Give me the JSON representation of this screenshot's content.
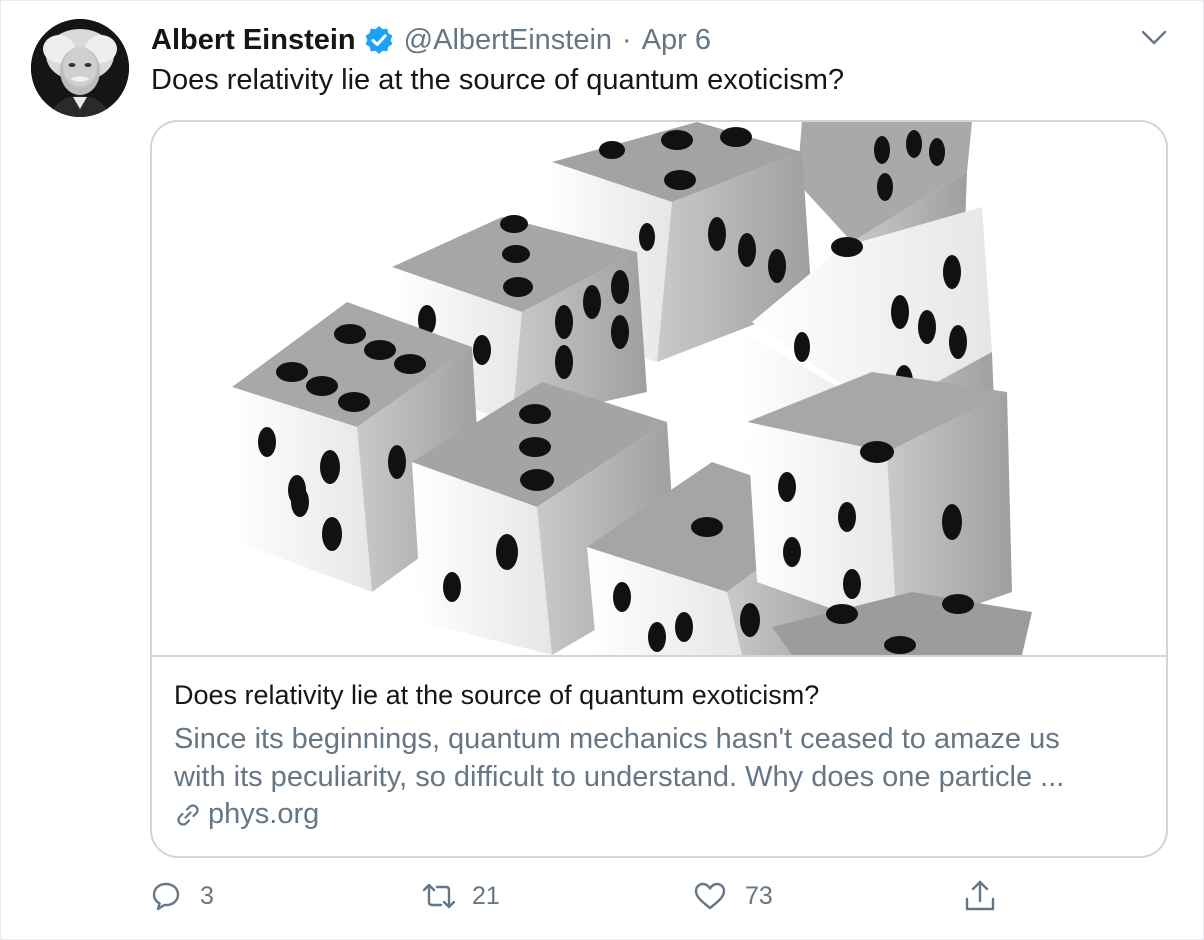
{
  "tweet": {
    "author_name": "Albert Einstein",
    "handle": "@AlbertEinstein",
    "separator": "·",
    "date": "Apr 6",
    "text": "Does relativity lie at the source of quantum exoticism?",
    "avatar_icon": "einstein-portrait",
    "verified_icon": "verified-badge-icon",
    "menu_icon": "chevron-down-icon"
  },
  "card": {
    "image_icon": "impossible-dice-triangle",
    "title": "Does relativity lie at the source of quantum exoticism?",
    "description_line1": "Since its beginnings, quantum mechanics hasn't ceased to amaze us",
    "description_line2": "with its peculiarity, so difficult to understand. Why does one particle ...",
    "link_icon": "link-icon",
    "domain": "phys.org"
  },
  "actions": {
    "reply_count": "3",
    "retweet_count": "21",
    "like_count": "73"
  },
  "colors": {
    "text": "#14171a",
    "secondary": "#657786",
    "border": "#ccd6dd",
    "verified": "#1da1f2"
  }
}
